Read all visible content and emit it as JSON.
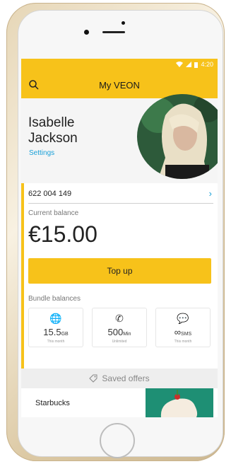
{
  "status_bar": {
    "time": "4:20",
    "icons": [
      "wifi-icon",
      "signal-icon",
      "battery-icon"
    ]
  },
  "app_bar": {
    "brand": "My VEON",
    "search_icon": "search-icon"
  },
  "profile": {
    "first_name": "Isabelle",
    "last_name": "Jackson",
    "settings_link": "Settings"
  },
  "account": {
    "number": "622 004 149"
  },
  "balance": {
    "label": "Current balance",
    "amount": "€15.00"
  },
  "top_up": {
    "label": "Top up"
  },
  "bundles": {
    "label": "Bundle balances",
    "items": [
      {
        "icon": "globe-icon",
        "value": "15.5",
        "unit": "GB",
        "note": "This month"
      },
      {
        "icon": "phone-icon",
        "value": "500",
        "unit": "Min",
        "note": "Unlimited"
      },
      {
        "icon": "message-icon",
        "value": "∞",
        "unit": "SMS",
        "note": "This month"
      }
    ]
  },
  "saved_offers": {
    "label": "Saved offers"
  },
  "offer": {
    "name": "Starbucks"
  },
  "colors": {
    "accent": "#f7c21a",
    "link": "#1aa0d8"
  }
}
